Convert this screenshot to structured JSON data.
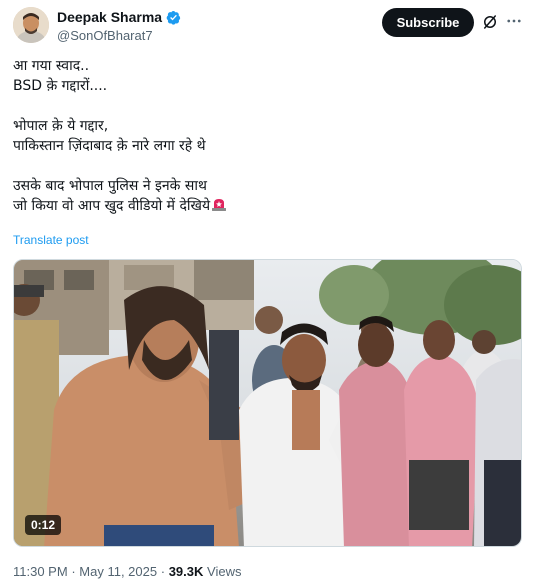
{
  "author": {
    "display_name": "Deepak Sharma",
    "handle": "@SonOfBharat7",
    "verified_icon": "verified-badge-icon"
  },
  "actions": {
    "subscribe_label": "Subscribe",
    "grok_icon": "grok-icon",
    "more_icon": "more-options-icon"
  },
  "tweet": {
    "lines_block1": [
      "आ गया स्वाद..",
      "BSD क़े गद्दारों...."
    ],
    "lines_block2": [
      "भोपाल क़े ये गद्दार,",
      "पाकिस्तान ज़िंदाबाद क़े नारे लगा रहे थे"
    ],
    "lines_block3": [
      "उसके बाद भोपाल पुलिस ने इनके साथ",
      "जो किया वो आप खुद वीडियो में देखिये"
    ],
    "emoji_icon": "police-siren-icon",
    "translate_label": "Translate post"
  },
  "video": {
    "duration": "0:12"
  },
  "meta": {
    "time": "11:30 PM",
    "separator": "·",
    "date": "May 11, 2025",
    "views_count": "39.3K",
    "views_label": "Views"
  }
}
